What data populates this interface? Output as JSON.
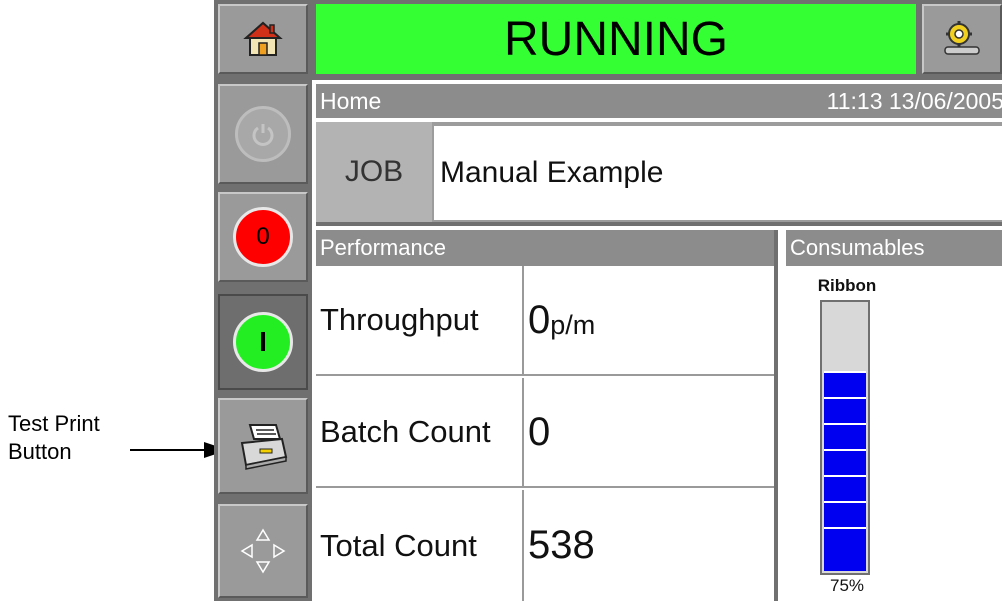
{
  "colors": {
    "status_bg": "#33ff33",
    "stop_red": "#ff0000",
    "start_green": "#22ee22",
    "ribbon_blue": "#0000f0",
    "panel_grey": "#9a9a9a",
    "header_grey": "#8c8c8c"
  },
  "icons": {
    "home": "home-icon",
    "settings": "settings-gear-wrench-icon",
    "power": "power-icon",
    "printer": "printer-icon",
    "navigate": "arrows-navigation-icon"
  },
  "status": {
    "text": "RUNNING"
  },
  "breadcrumb": {
    "page": "Home",
    "datetime": "11:13 13/06/2005"
  },
  "job": {
    "label": "JOB",
    "name": "Manual Example"
  },
  "performance": {
    "title": "Performance",
    "rows": [
      {
        "label": "Throughput",
        "value": "0",
        "unit": "p/m"
      },
      {
        "label": "Batch Count",
        "value": "0",
        "unit": ""
      },
      {
        "label": "Total Count",
        "value": "538",
        "unit": ""
      }
    ]
  },
  "consumables": {
    "title": "Consumables",
    "ribbon_label": "Ribbon",
    "ribbon_percent_text": "75%",
    "ribbon_level": 0.75
  },
  "side_buttons": {
    "stop_label": "0",
    "start_label": "I"
  },
  "callout": {
    "text_line1": "Test Print",
    "text_line2": "Button"
  }
}
